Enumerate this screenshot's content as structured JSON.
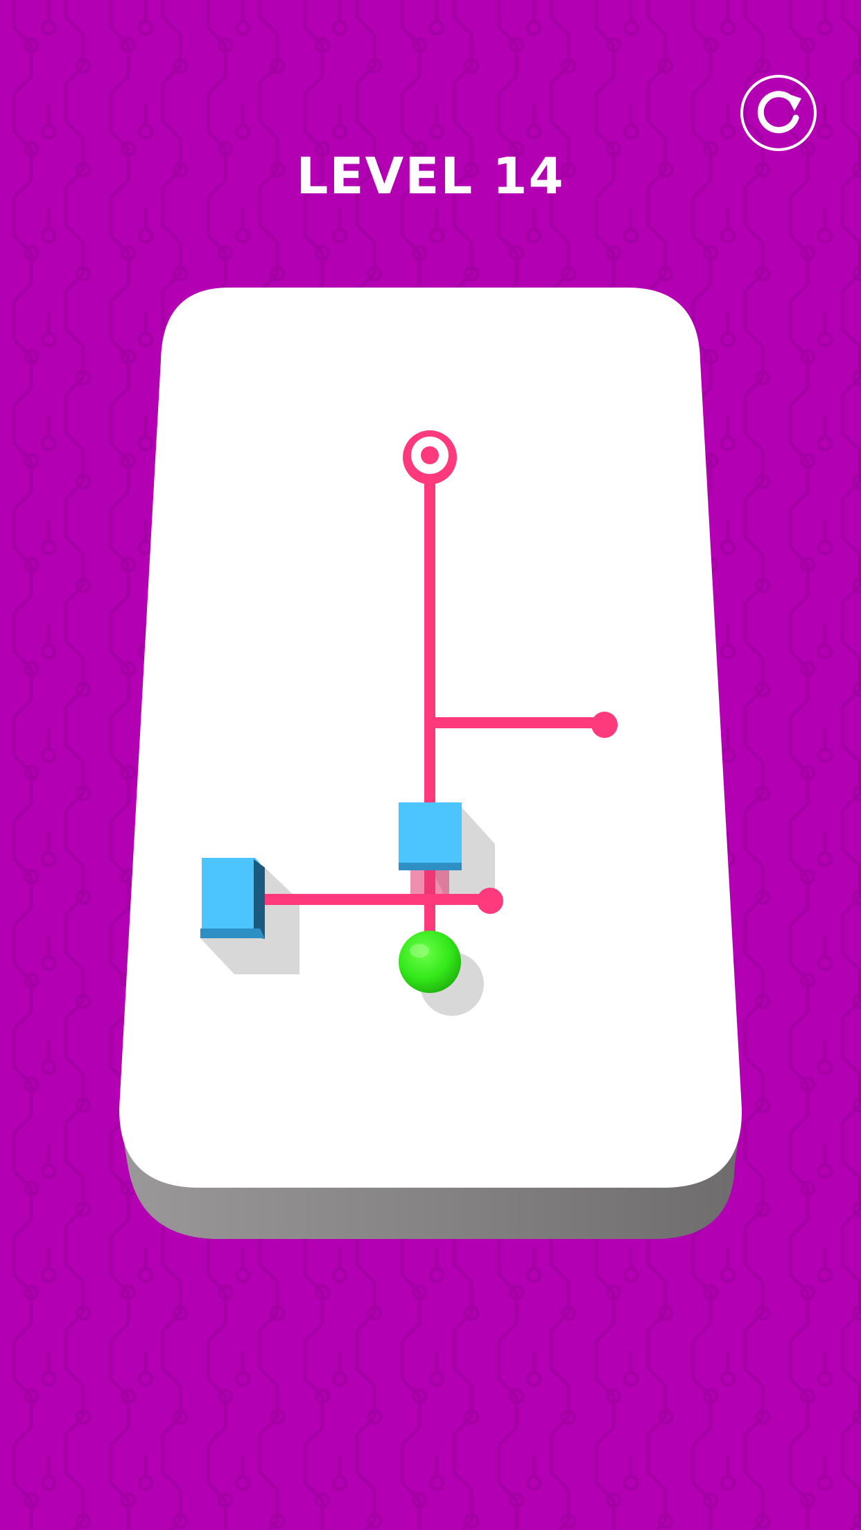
{
  "hud": {
    "level_label": "LEVEL 14",
    "restart_icon": "restart-icon"
  },
  "colors": {
    "background": "#b300b3",
    "pattern": "#a800a8",
    "board_top": "#ffffff",
    "board_side": "#8a8888",
    "rail": "#ff3a7c",
    "block": "#4cc5ff",
    "block_dark": "#1b6f9c",
    "ball": "#36e81d",
    "target": "#ff3a7c"
  },
  "game": {
    "target": "goal-ring",
    "blocks": [
      "blue-block-center",
      "blue-block-left"
    ],
    "ball": "green-ball"
  }
}
